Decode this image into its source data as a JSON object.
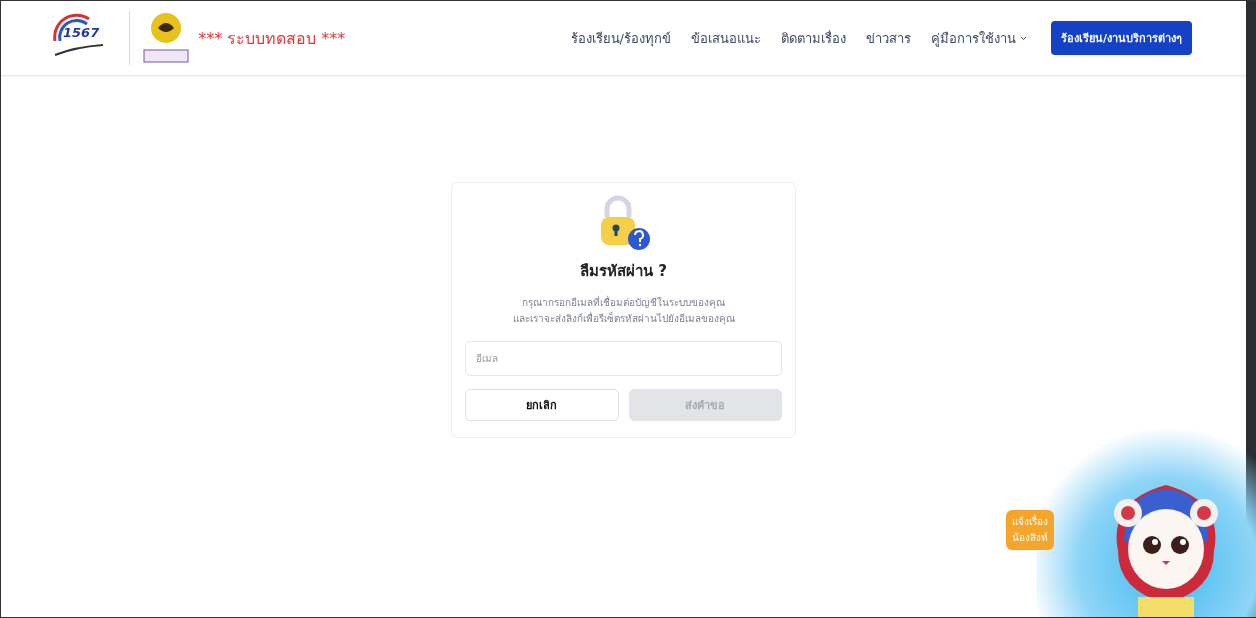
{
  "header": {
    "logo_text": "1567",
    "site_title": "*** ระบบทดสอบ ***",
    "nav": [
      {
        "label": "ร้องเรียน/ร้องทุกข์",
        "kind": "link"
      },
      {
        "label": "ข้อเสนอแนะ",
        "kind": "link"
      },
      {
        "label": "ติดตามเรื่อง",
        "kind": "link"
      },
      {
        "label": "ข่าวสาร",
        "kind": "link"
      },
      {
        "label": "คู่มือการใช้งาน",
        "kind": "dropdown"
      }
    ],
    "cta": "ร้องเรียน/งานบริการต่างๆ"
  },
  "card": {
    "title": "ลืมรหัสผ่าน ?",
    "description": [
      "กรุณากรอกอีเมลที่เชื่อมต่อบัญชีในระบบของคุณ",
      "และเราจะส่งลิงก์เพื่อรีเซ็ตรหัสผ่านไปยังอีเมลของคุณ"
    ],
    "email": {
      "placeholder": "อีเมล"
    },
    "buttons": [
      {
        "label": "ยกเลิก",
        "disabled": false
      },
      {
        "label": "ส่งคำขอ",
        "disabled": true
      }
    ]
  },
  "chat": {
    "bubble": [
      "แจ้งเรื่อง",
      "น้องสิงห์"
    ]
  }
}
